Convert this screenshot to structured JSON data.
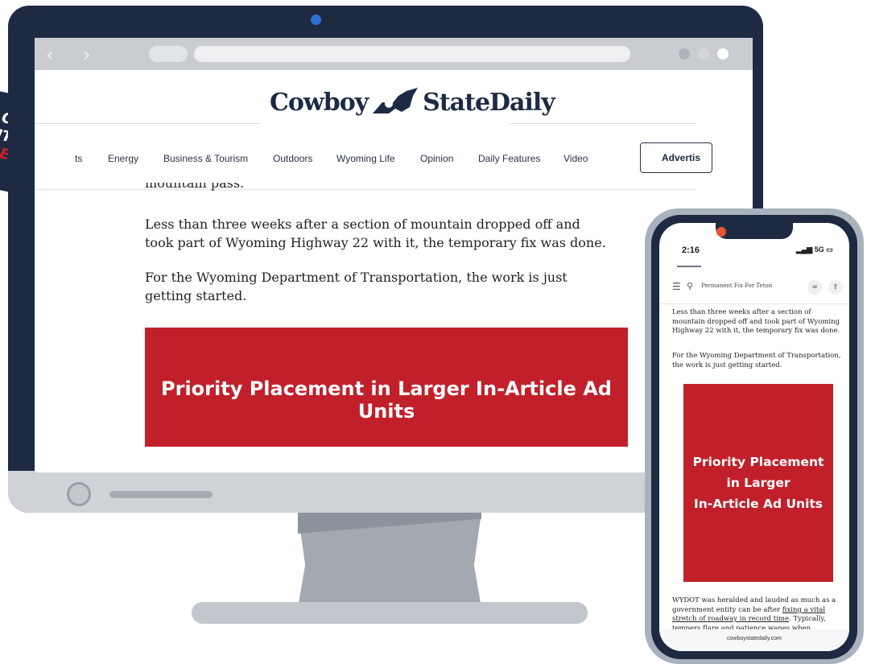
{
  "badge": {
    "line1": "O",
    "line2": "IT",
    "line3": "UE"
  },
  "browser": {
    "back_icon": "chevron-left-icon",
    "forward_icon": "chevron-right-icon",
    "dot_colors": [
      "#aeb3b9",
      "#d3d6da",
      "#ffffff"
    ]
  },
  "site": {
    "logo_left": "Cowboy",
    "logo_right": "StateDaily",
    "nav_items": [
      "ts",
      "Energy",
      "Business & Tourism",
      "Outdoors",
      "Wyoming Life",
      "Opinion",
      "Daily Features",
      "Video"
    ],
    "advertise_label": "Advertis"
  },
  "article": {
    "partial_line": "mountain pass.",
    "p1": "Less than three weeks after a section of mountain dropped off and took part of Wyoming Highway 22 with it, the temporary fix was done.",
    "p2": "For the Wyoming Department of Transportation, the work is just getting started."
  },
  "ad": {
    "desktop_text": "Priority Placement in Larger In-Article Ad Units",
    "mobile_lines": [
      "Priority Placement",
      "in Larger",
      "In-Article Ad Units"
    ],
    "color": "#c1202a"
  },
  "phone": {
    "time": "2:16",
    "signal": "5G",
    "tab_title": "Permanent Fix For Teton Pass",
    "p1": "Less than three weeks after a section of mountain dropped off and took part of Wyoming Highway 22 with it, the temporary fix was done.",
    "p2": "For the Wyoming Department of Transportation, the work is just getting started.",
    "p3_start": "WYDOT was heralded and lauded as much as a government entity can be after ",
    "p3_link": "fixing a vital stretch of roadway in record time",
    "p3_end": ". Typically, tempers flare and patience wanes when travelers",
    "footer_url": "cowboystatedaily.com"
  },
  "colors": {
    "navy": "#1d2a42",
    "accent_red": "#c1202a"
  }
}
